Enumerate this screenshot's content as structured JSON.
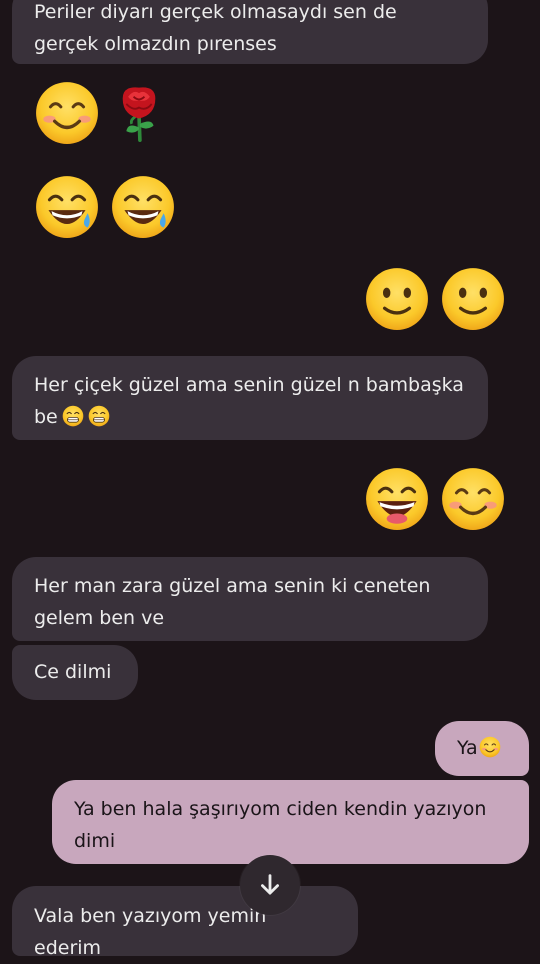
{
  "messages": [
    {
      "id": "m1",
      "side": "received",
      "text": "Periler diyarı gerçek olmasaydı sen de gerçek olmazdın pırenses"
    },
    {
      "id": "m2",
      "side": "received",
      "emojis": [
        "blush-smile",
        "rose"
      ]
    },
    {
      "id": "m3",
      "side": "received",
      "emojis": [
        "grin-sweat",
        "grin-sweat"
      ]
    },
    {
      "id": "m4",
      "side": "sent",
      "emojis": [
        "slight-smile",
        "slight-smile"
      ]
    },
    {
      "id": "m5",
      "side": "received",
      "text": "Her çiçek güzel ama senin güzel n bambaşka be",
      "trailing_emojis": [
        "beaming-grin",
        "beaming-grin"
      ]
    },
    {
      "id": "m6",
      "side": "sent",
      "emojis": [
        "big-grin",
        "blush-smile"
      ]
    },
    {
      "id": "m7",
      "side": "received",
      "text": "Her man zara güzel ama senin ki  ceneten gelem ben ve"
    },
    {
      "id": "m8",
      "side": "received",
      "text": "Ce dilmi"
    },
    {
      "id": "m9",
      "side": "sent",
      "text": "Ya",
      "trailing_emojis": [
        "blush-smile"
      ]
    },
    {
      "id": "m10",
      "side": "sent",
      "text": "Ya ben hala şaşırıyom ciden kendin yazıyon dimi"
    },
    {
      "id": "m11",
      "side": "received",
      "text": "Vala ben yazıyom yemin ederim"
    }
  ],
  "scroll_button": {
    "icon": "arrow-down-icon"
  },
  "colors": {
    "background": "#1c1418",
    "received_bubble": "#39313a",
    "sent_bubble": "#c8a7bd",
    "emoji_yellow": "#f9c323"
  }
}
